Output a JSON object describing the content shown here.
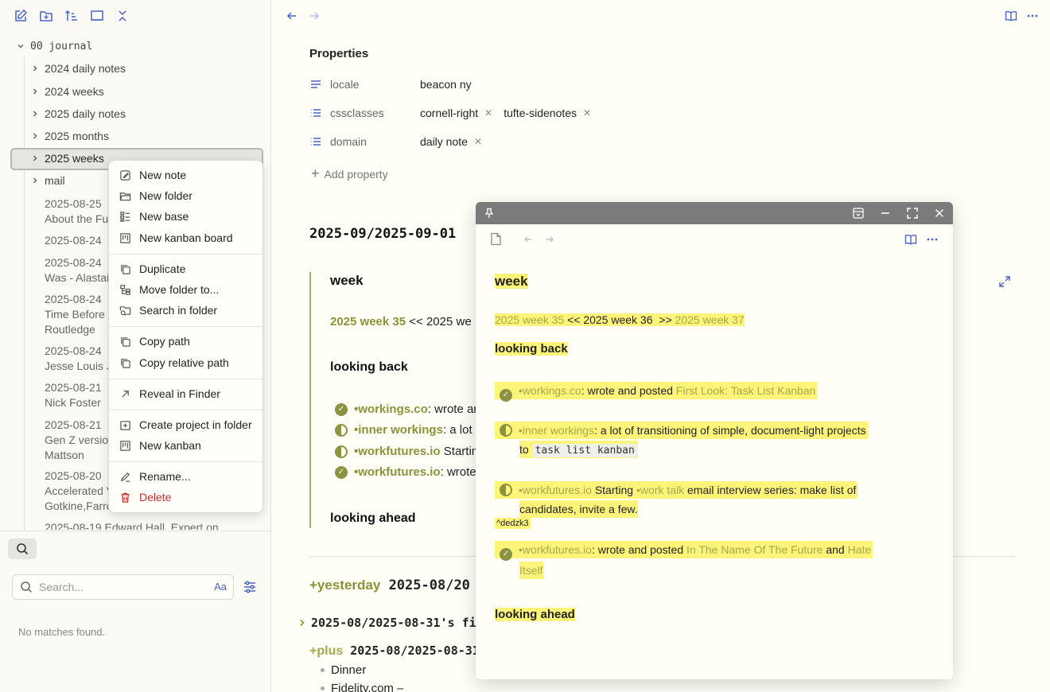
{
  "sidebar": {
    "toolbar": [
      "new-note-icon",
      "new-folder-icon",
      "sort-icon",
      "collapse-panel-icon",
      "collapse-all-icon"
    ],
    "root_folder": "00 journal",
    "folders": [
      "2024 daily notes",
      "2024 weeks",
      "2025 daily notes",
      "2025 months",
      "2025 weeks",
      "mail"
    ],
    "files": [
      [
        "2025-08-25",
        "About the Fu"
      ],
      [
        "2025-08-24"
      ],
      [
        "2025-08-24",
        "Was - Alastai"
      ],
      [
        "2025-08-24",
        "Time Before",
        "Routledge"
      ],
      [
        "2025-08-24",
        "Jesse Louis J"
      ],
      [
        "2025-08-21",
        "Nick Foster"
      ],
      [
        "2025-08-21",
        "Gen Z version",
        "Mattson"
      ],
      [
        "2025-08-20",
        "Accelerated V",
        "Gotkine,Farro"
      ],
      [
        "2025-08-19 Edward Hall, Expert on"
      ]
    ],
    "search": {
      "placeholder": "Search...",
      "case_label": "Aa",
      "no_matches": "No matches found."
    }
  },
  "context_menu": {
    "new_note": "New note",
    "new_folder": "New folder",
    "new_base": "New base",
    "new_kanban_board": "New kanban board",
    "duplicate": "Duplicate",
    "move_folder": "Move folder to...",
    "search_in_folder": "Search in folder",
    "copy_path": "Copy path",
    "copy_relative_path": "Copy relative path",
    "reveal_in_finder": "Reveal in Finder",
    "create_project": "Create project in folder",
    "new_kanban": "New kanban",
    "rename": "Rename...",
    "delete": "Delete"
  },
  "note": {
    "properties_title": "Properties",
    "properties": [
      {
        "name": "locale",
        "values": [
          "beacon ny"
        ],
        "removable": false
      },
      {
        "name": "cssclasses",
        "values": [
          "cornell-right",
          "tufte-sidenotes"
        ],
        "removable": true
      },
      {
        "name": "domain",
        "values": [
          "daily note"
        ],
        "removable": true
      }
    ],
    "add_property": "Add property",
    "heading": "2025-09/2025-09-01",
    "week_heading": "week",
    "week_nav_prev": "2025 week 35",
    "week_nav_rest": " << 2025 we",
    "looking_back": "looking back",
    "items": [
      {
        "status": "done",
        "link": "•workings.co",
        "text": ": wrote ar"
      },
      {
        "status": "half",
        "link": "•inner workings",
        "text": ": a lot"
      },
      {
        "status": "half",
        "link": "•workfutures.io",
        "text": " Startin"
      },
      {
        "status": "done",
        "link": "•workfutures.io",
        "text": ": wrote"
      }
    ],
    "looking_ahead": "looking ahead",
    "yesterday_tag": "+yesterday",
    "yesterday_date": " 2025-08/20",
    "files_heading": "2025-08/2025-08-31's files",
    "plus_tag": "+plus",
    "plus_date": " 2025-08/2025-08-31",
    "bullets": [
      "Dinner",
      "Fidelity.com –"
    ]
  },
  "popover": {
    "week_heading": "week",
    "nav_prev": "2025 week 35",
    "nav_mid": " << 2025 week 36  >> ",
    "nav_next": "2025 week 37",
    "looking_back": "looking back",
    "item1": {
      "link": "•workings.co",
      "text": ": wrote and posted ",
      "link2": "First Look: Task List Kanban"
    },
    "item2": {
      "link": "•inner workings",
      "text": ": a lot of transitioning of simple, document-light projects",
      "text2": "to ",
      "code": "task list kanban"
    },
    "item3": {
      "link": "•workfutures.io",
      "text": " Starting ",
      "link2": "•work talk",
      "text2": " email interview series: make list of",
      "text3": "candidates, invite a few."
    },
    "block_id": "^dedzk3",
    "item4": {
      "link": "•workfutures.io",
      "text": ": wrote and posted ",
      "link2": "In The Name Of The Future",
      "text2": " and ",
      "link3": "Hate",
      "link4": "Itself"
    },
    "looking_ahead": "looking ahead"
  },
  "colors": {
    "accent": "#4a64c8",
    "olive": "#8a9338",
    "highlight": "#fff47a",
    "delete": "#d02a2a"
  }
}
